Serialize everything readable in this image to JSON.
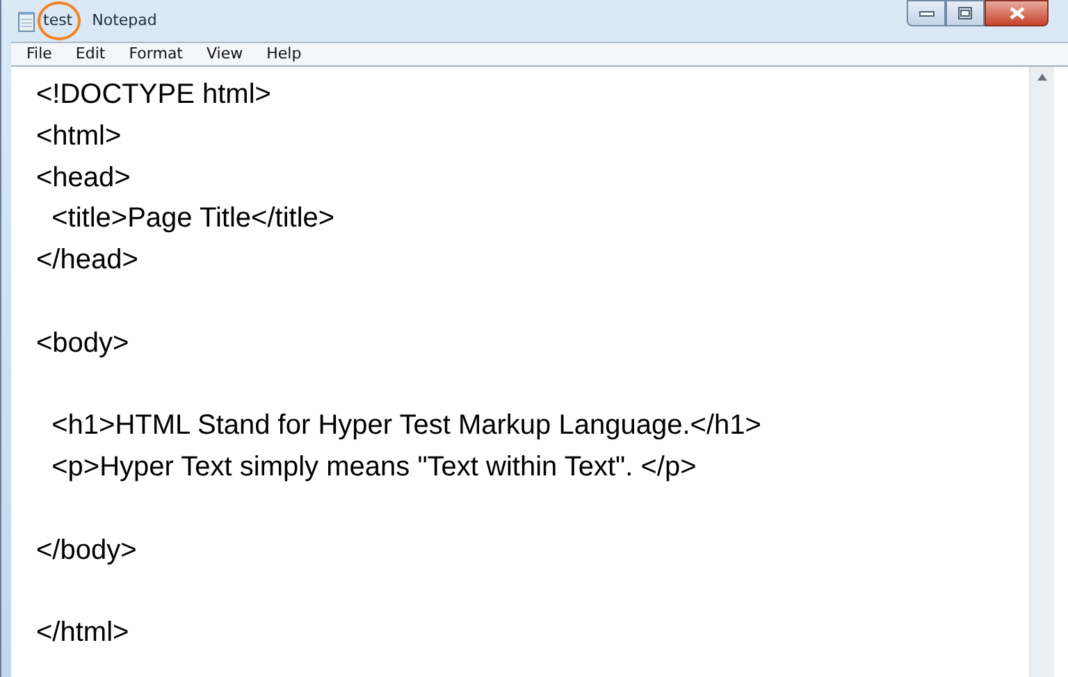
{
  "window": {
    "document_name": "test",
    "app_name": "Notepad",
    "highlight_circle": true
  },
  "menu": [
    "File",
    "Edit",
    "Format",
    "View",
    "Help"
  ],
  "editor": {
    "lines": [
      {
        "kind": "text",
        "text": "<!DOCTYPE html>"
      },
      {
        "kind": "text",
        "text": "<html>"
      },
      {
        "kind": "text",
        "text": "<head>"
      },
      {
        "kind": "text",
        "text": "  <title>Page Title</title>"
      },
      {
        "kind": "text",
        "text": "</head>"
      },
      {
        "kind": "blank"
      },
      {
        "kind": "text",
        "text": "<body>"
      },
      {
        "kind": "blank"
      },
      {
        "kind": "text",
        "text": "  <h1>HTML Stand for Hyper Test Markup Language.</h1>"
      },
      {
        "kind": "text",
        "text": "  <p>Hyper Text simply means \"Text within Text\". </p>"
      },
      {
        "kind": "blank"
      },
      {
        "kind": "text",
        "text": "</body>"
      },
      {
        "kind": "blank"
      },
      {
        "kind": "text",
        "text": "</html>"
      }
    ]
  }
}
